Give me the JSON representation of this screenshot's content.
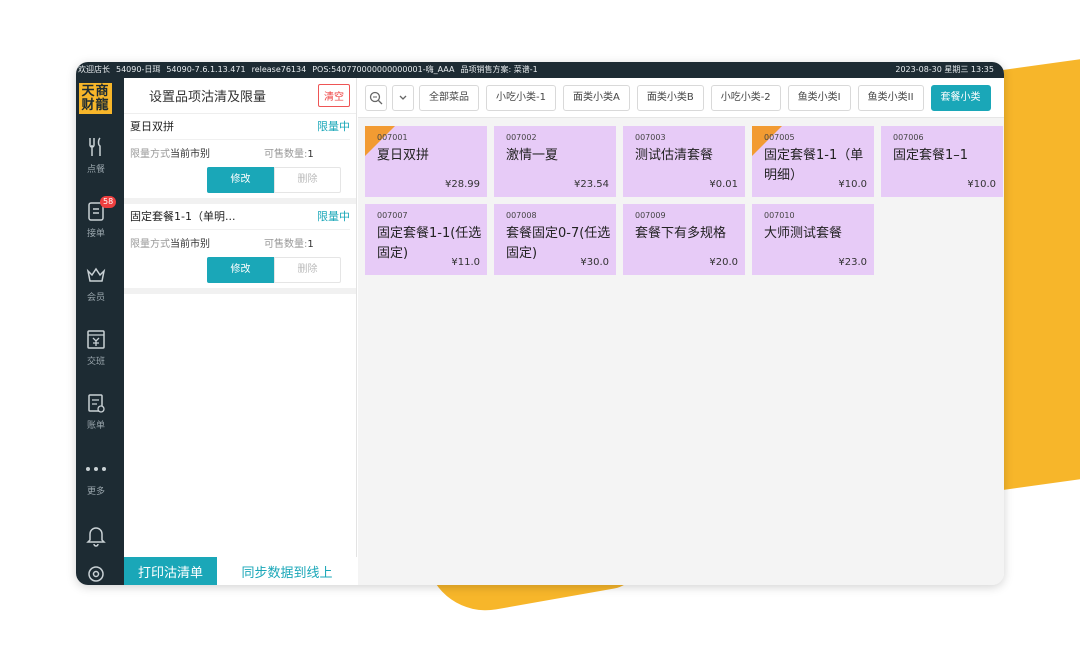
{
  "status_bar": {
    "left_items": [
      "欢迎店长",
      "54090-日珥",
      "54090-7.6.1.13.471",
      "release76134",
      "POS:540770000000000001-嗨_AAA",
      "品项销售方案: 菜谱-1"
    ],
    "datetime": "2023-08-30  星期三  13:35"
  },
  "logo": {
    "line1": "天商",
    "line2": "财龍"
  },
  "rail": {
    "items": [
      {
        "label": "点餐",
        "icon": "fork-knife-icon"
      },
      {
        "label": "接单",
        "icon": "order-clipboard-icon",
        "badge": "58"
      },
      {
        "label": "会员",
        "icon": "crown-icon"
      },
      {
        "label": "交班",
        "icon": "cash-register-icon"
      },
      {
        "label": "账单",
        "icon": "bill-icon"
      },
      {
        "label": "更多",
        "icon": "more-dots-icon"
      }
    ]
  },
  "left_panel": {
    "title": "设置品项沽清及限量",
    "clear_label": "清空",
    "items": [
      {
        "name": "夏日双拼",
        "tag": "限量中",
        "mode_label": "限量方式",
        "mode_value": "当前市别",
        "qty_label": "可售数量:",
        "qty_value": "1",
        "edit": "修改",
        "delete": "删除"
      },
      {
        "name": "固定套餐1-1（单明...",
        "tag": "限量中",
        "mode_label": "限量方式",
        "mode_value": "当前市别",
        "qty_label": "可售数量:",
        "qty_value": "1",
        "edit": "修改",
        "delete": "删除"
      }
    ],
    "print_label": "打印沽清单",
    "sync_label": "同步数据到线上"
  },
  "categories": [
    "全部菜品",
    "小吃小类-1",
    "面类小类A",
    "面类小类B",
    "小吃小类-2",
    "鱼类小类I",
    "鱼类小类II",
    "套餐小类"
  ],
  "active_category": "套餐小类",
  "dishes": [
    {
      "code": "007001",
      "name": "夏日双拼",
      "price": "¥28.99",
      "flag": true
    },
    {
      "code": "007002",
      "name": "激情一夏",
      "price": "¥23.54",
      "flag": false
    },
    {
      "code": "007003",
      "name": "测试估清套餐",
      "price": "¥0.01",
      "flag": false
    },
    {
      "code": "007005",
      "name": "固定套餐1-1（单明细）",
      "price": "¥10.0",
      "flag": true
    },
    {
      "code": "007006",
      "name": "固定套餐1–1",
      "price": "¥10.0",
      "flag": false
    },
    {
      "code": "007007",
      "name": "固定套餐1-1(任选固定)",
      "price": "¥11.0",
      "flag": false
    },
    {
      "code": "007008",
      "name": "套餐固定0-7(任选固定)",
      "price": "¥30.0",
      "flag": false
    },
    {
      "code": "007009",
      "name": "套餐下有多规格",
      "price": "¥20.0",
      "flag": false
    },
    {
      "code": "007010",
      "name": "大师测试套餐",
      "price": "¥23.0",
      "flag": false
    }
  ],
  "colors": {
    "accent": "#1aa7b8",
    "dish_card": "#e7cbf7",
    "rail": "#1d2b33",
    "flag": "#f29b32",
    "brand_yellow": "#f7b62a",
    "badge": "#ee3f3f"
  }
}
